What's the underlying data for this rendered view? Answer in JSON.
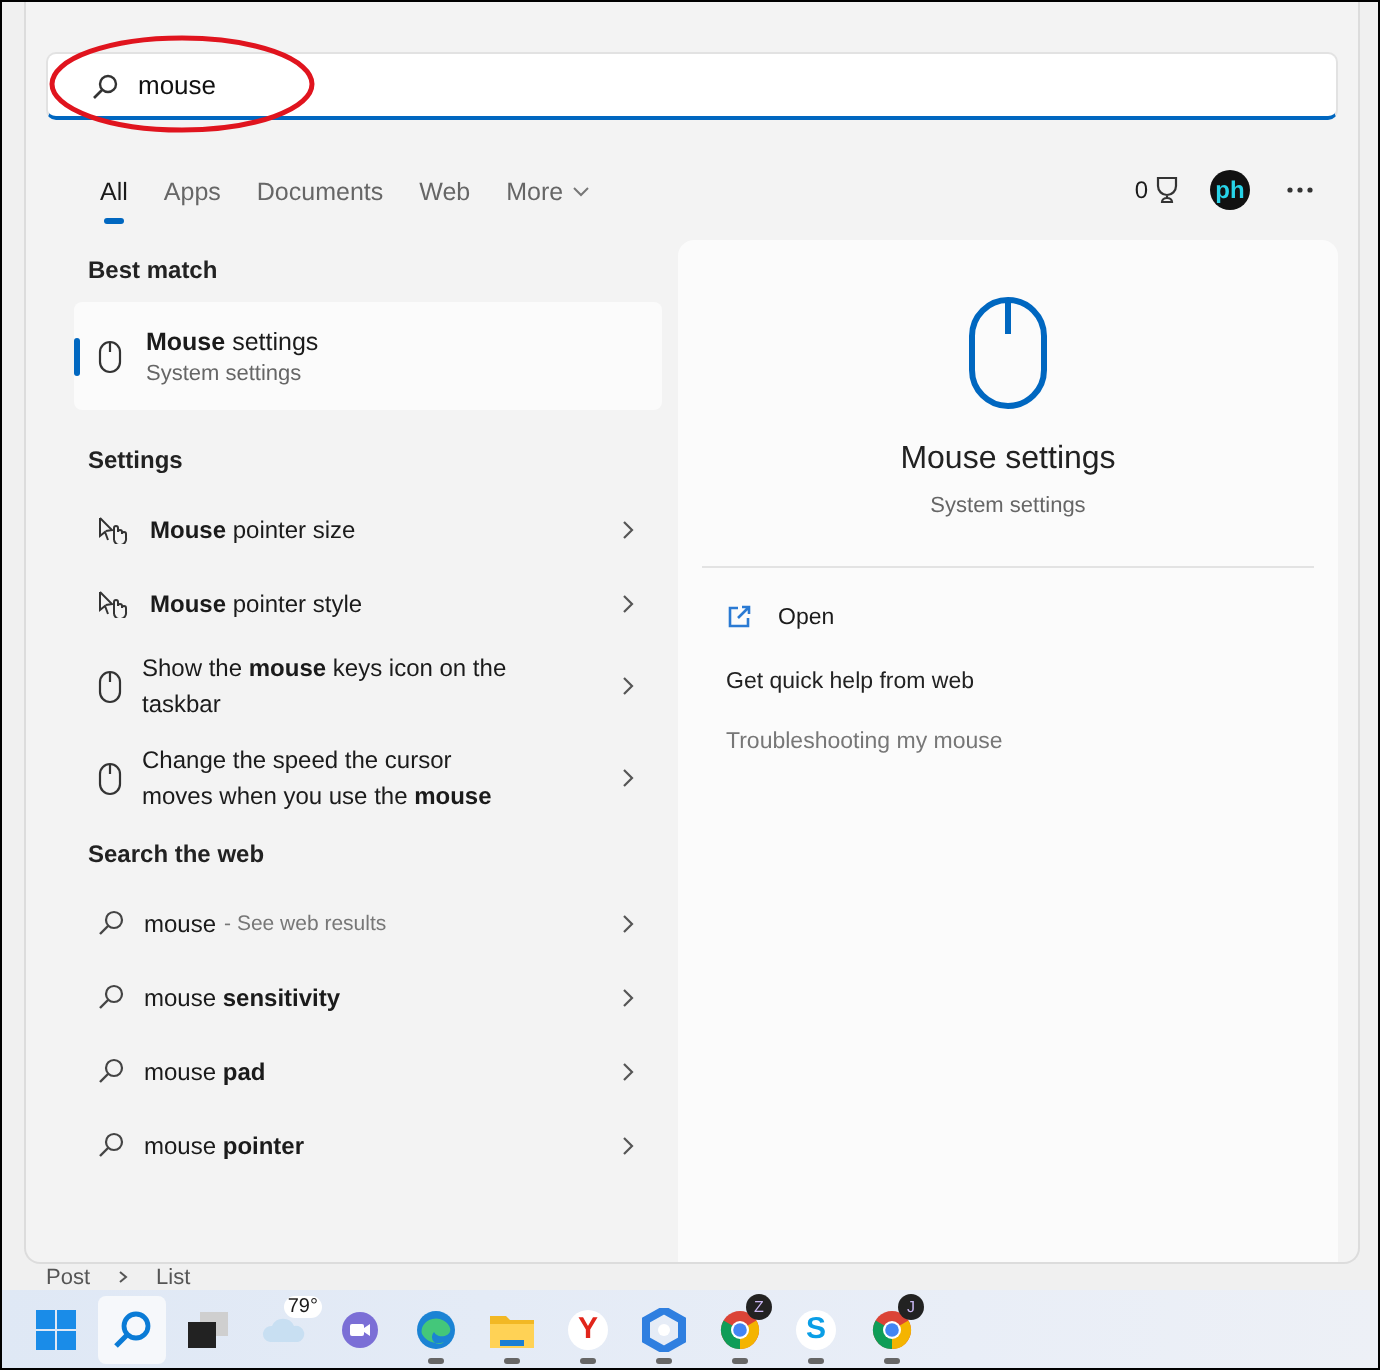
{
  "search": {
    "value": "mouse"
  },
  "tabs": [
    {
      "label": "All",
      "selected": true
    },
    {
      "label": "Apps",
      "selected": false
    },
    {
      "label": "Documents",
      "selected": false
    },
    {
      "label": "Web",
      "selected": false
    },
    {
      "label": "More",
      "selected": false,
      "kind": "dropdown"
    }
  ],
  "toolbar": {
    "points": "0",
    "avatar": "ph"
  },
  "best_match": {
    "heading": "Best match",
    "title": "**Mouse** settings",
    "subtitle": "System settings",
    "selected": true
  },
  "settings": {
    "heading": "Settings",
    "items": [
      {
        "kind": "pointer",
        "text": "**Mouse** pointer size"
      },
      {
        "kind": "pointer",
        "text": "**Mouse** pointer style"
      },
      {
        "kind": "mouse",
        "text": "Show the **mouse** keys icon on the taskbar"
      },
      {
        "kind": "mouse",
        "text": "Change the speed the cursor moves when you use the **mouse**"
      }
    ]
  },
  "web": {
    "heading": "Search the web",
    "items": [
      {
        "text": "mouse",
        "hint": "- See web results"
      },
      {
        "text": "mouse **sensitivity**"
      },
      {
        "text": "mouse **pad**"
      },
      {
        "text": "mouse **pointer**"
      }
    ]
  },
  "detail": {
    "title": "Mouse settings",
    "subtitle": "System settings",
    "actions": [
      {
        "kind": "open",
        "label": "Open"
      },
      {
        "kind": "heading",
        "label": "Get quick help from web"
      },
      {
        "kind": "link",
        "label": "Troubleshooting my mouse"
      }
    ]
  },
  "behind": [
    "Post",
    "List"
  ],
  "taskbar": [
    {
      "kind": "start",
      "running": false,
      "selected": false
    },
    {
      "kind": "search",
      "running": false,
      "selected": true
    },
    {
      "kind": "taskview",
      "running": false,
      "selected": false
    },
    {
      "kind": "weather",
      "label": "79°",
      "running": false,
      "selected": false
    },
    {
      "kind": "chat",
      "running": false,
      "selected": false
    },
    {
      "kind": "edge",
      "running": true,
      "selected": false
    },
    {
      "kind": "files",
      "running": true,
      "selected": false
    },
    {
      "kind": "letter",
      "label": "Y",
      "color": "#e1251b",
      "running": true,
      "selected": false
    },
    {
      "kind": "copilot",
      "running": true,
      "selected": false
    },
    {
      "kind": "chrome",
      "badge": "Z",
      "running": true,
      "selected": false
    },
    {
      "kind": "letter",
      "label": "S",
      "color": "#0a9ee6",
      "running": true,
      "selected": false
    },
    {
      "kind": "chrome",
      "badge": "J",
      "running": true,
      "selected": false
    }
  ]
}
